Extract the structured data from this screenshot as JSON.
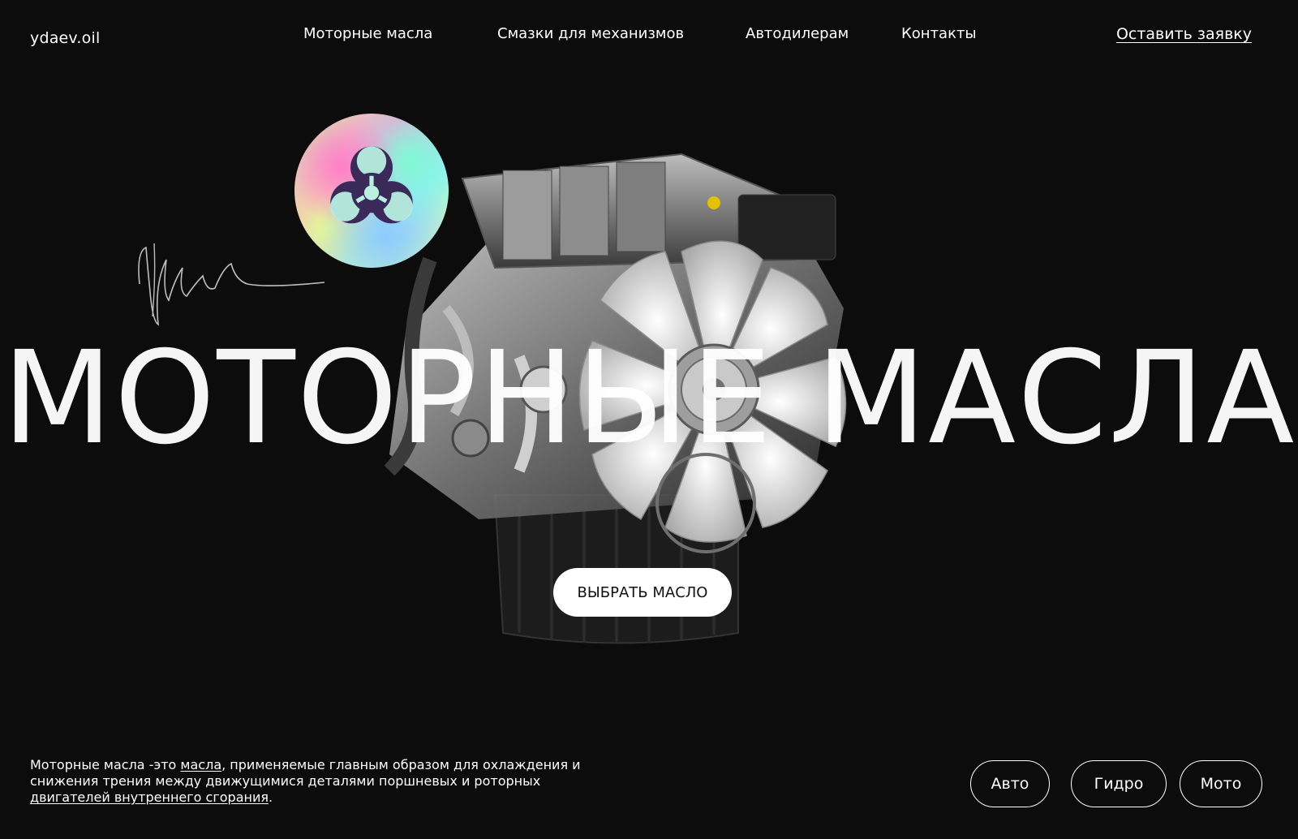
{
  "header": {
    "logo": "ydaev.oil",
    "nav": [
      "Моторные масла",
      "Смазки для механизмов",
      "Автодилерам",
      "Контакты"
    ],
    "cta": "Оставить заявку"
  },
  "hero": {
    "title": "МОТОРНЫЕ МАСЛА",
    "button": "ВЫБРАТЬ МАСЛО",
    "sticker_icon": "biohazard-icon"
  },
  "description": {
    "part1": "Моторные масла -это ",
    "link1": "масла",
    "part2": ", применяемые главным образом для охлаждения и снижения трения между движущимися деталями поршневых и роторных ",
    "link2": "двигателей внутреннего сгорания",
    "part3": "."
  },
  "categories": [
    "Авто",
    "Гидро",
    "Мото"
  ],
  "colors": {
    "background": "#0c0c0c",
    "text": "#ffffff",
    "button_bg": "#ffffff"
  }
}
